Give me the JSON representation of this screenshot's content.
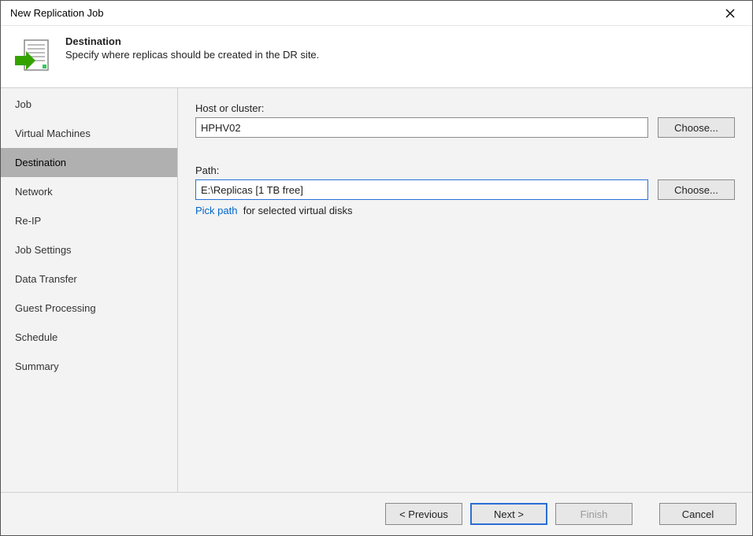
{
  "window": {
    "title": "New Replication Job"
  },
  "header": {
    "title": "Destination",
    "description": "Specify where replicas should be created in the DR site."
  },
  "sidebar": {
    "items": [
      {
        "label": "Job",
        "active": false
      },
      {
        "label": "Virtual Machines",
        "active": false
      },
      {
        "label": "Destination",
        "active": true
      },
      {
        "label": "Network",
        "active": false
      },
      {
        "label": "Re-IP",
        "active": false
      },
      {
        "label": "Job Settings",
        "active": false
      },
      {
        "label": "Data Transfer",
        "active": false
      },
      {
        "label": "Guest Processing",
        "active": false
      },
      {
        "label": "Schedule",
        "active": false
      },
      {
        "label": "Summary",
        "active": false
      }
    ]
  },
  "content": {
    "host_label": "Host or cluster:",
    "host_value": "HPHV02",
    "host_choose": "Choose...",
    "path_label": "Path:",
    "path_value": "E:\\Replicas [1 TB free]",
    "path_choose": "Choose...",
    "pick_link": "Pick path",
    "pick_suffix": "for selected virtual disks"
  },
  "footer": {
    "previous": "< Previous",
    "next": "Next >",
    "finish": "Finish",
    "cancel": "Cancel"
  }
}
